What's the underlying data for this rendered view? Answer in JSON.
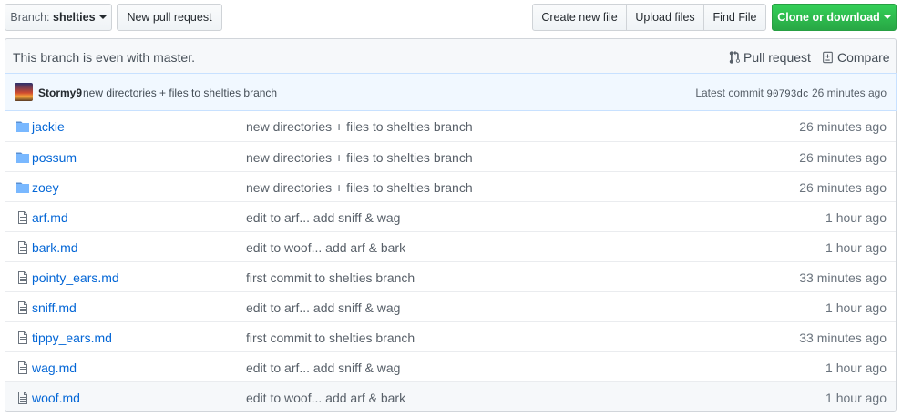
{
  "toolbar": {
    "branch_label": "Branch:",
    "branch_name": "shelties",
    "new_pull_request": "New pull request",
    "create_new_file": "Create new file",
    "upload_files": "Upload files",
    "find_file": "Find File",
    "clone_or_download": "Clone or download",
    "clone_color": "#2cbe4e"
  },
  "branch_info": {
    "message": "This branch is even with master.",
    "pull_request": "Pull request",
    "compare": "Compare"
  },
  "commit": {
    "author": "Stormy9",
    "message": "new directories + files to shelties branch",
    "latest_label": "Latest commit",
    "sha": "90793dc",
    "age": "26 minutes ago"
  },
  "files": [
    {
      "type": "folder",
      "icon": "folder-icon",
      "name": "jackie",
      "message": "new directories + files to shelties branch",
      "age": "26 minutes ago"
    },
    {
      "type": "folder",
      "icon": "folder-icon",
      "name": "possum",
      "message": "new directories + files to shelties branch",
      "age": "26 minutes ago"
    },
    {
      "type": "folder",
      "icon": "folder-icon",
      "name": "zoey",
      "message": "new directories + files to shelties branch",
      "age": "26 minutes ago"
    },
    {
      "type": "file",
      "icon": "file-icon",
      "name": "arf.md",
      "message": "edit to arf... add sniff & wag",
      "age": "1 hour ago"
    },
    {
      "type": "file",
      "icon": "file-icon",
      "name": "bark.md",
      "message": "edit to woof... add arf & bark",
      "age": "1 hour ago"
    },
    {
      "type": "file",
      "icon": "file-icon",
      "name": "pointy_ears.md",
      "message": "first commit to shelties branch",
      "age": "33 minutes ago"
    },
    {
      "type": "file",
      "icon": "file-icon",
      "name": "sniff.md",
      "message": "edit to arf... add sniff & wag",
      "age": "1 hour ago"
    },
    {
      "type": "file",
      "icon": "file-icon",
      "name": "tippy_ears.md",
      "message": "first commit to shelties branch",
      "age": "33 minutes ago"
    },
    {
      "type": "file",
      "icon": "file-icon",
      "name": "wag.md",
      "message": "edit to arf... add sniff & wag",
      "age": "1 hour ago"
    },
    {
      "type": "file",
      "icon": "file-icon",
      "name": "woof.md",
      "message": "edit to woof... add arf & bark",
      "age": "1 hour ago"
    }
  ]
}
